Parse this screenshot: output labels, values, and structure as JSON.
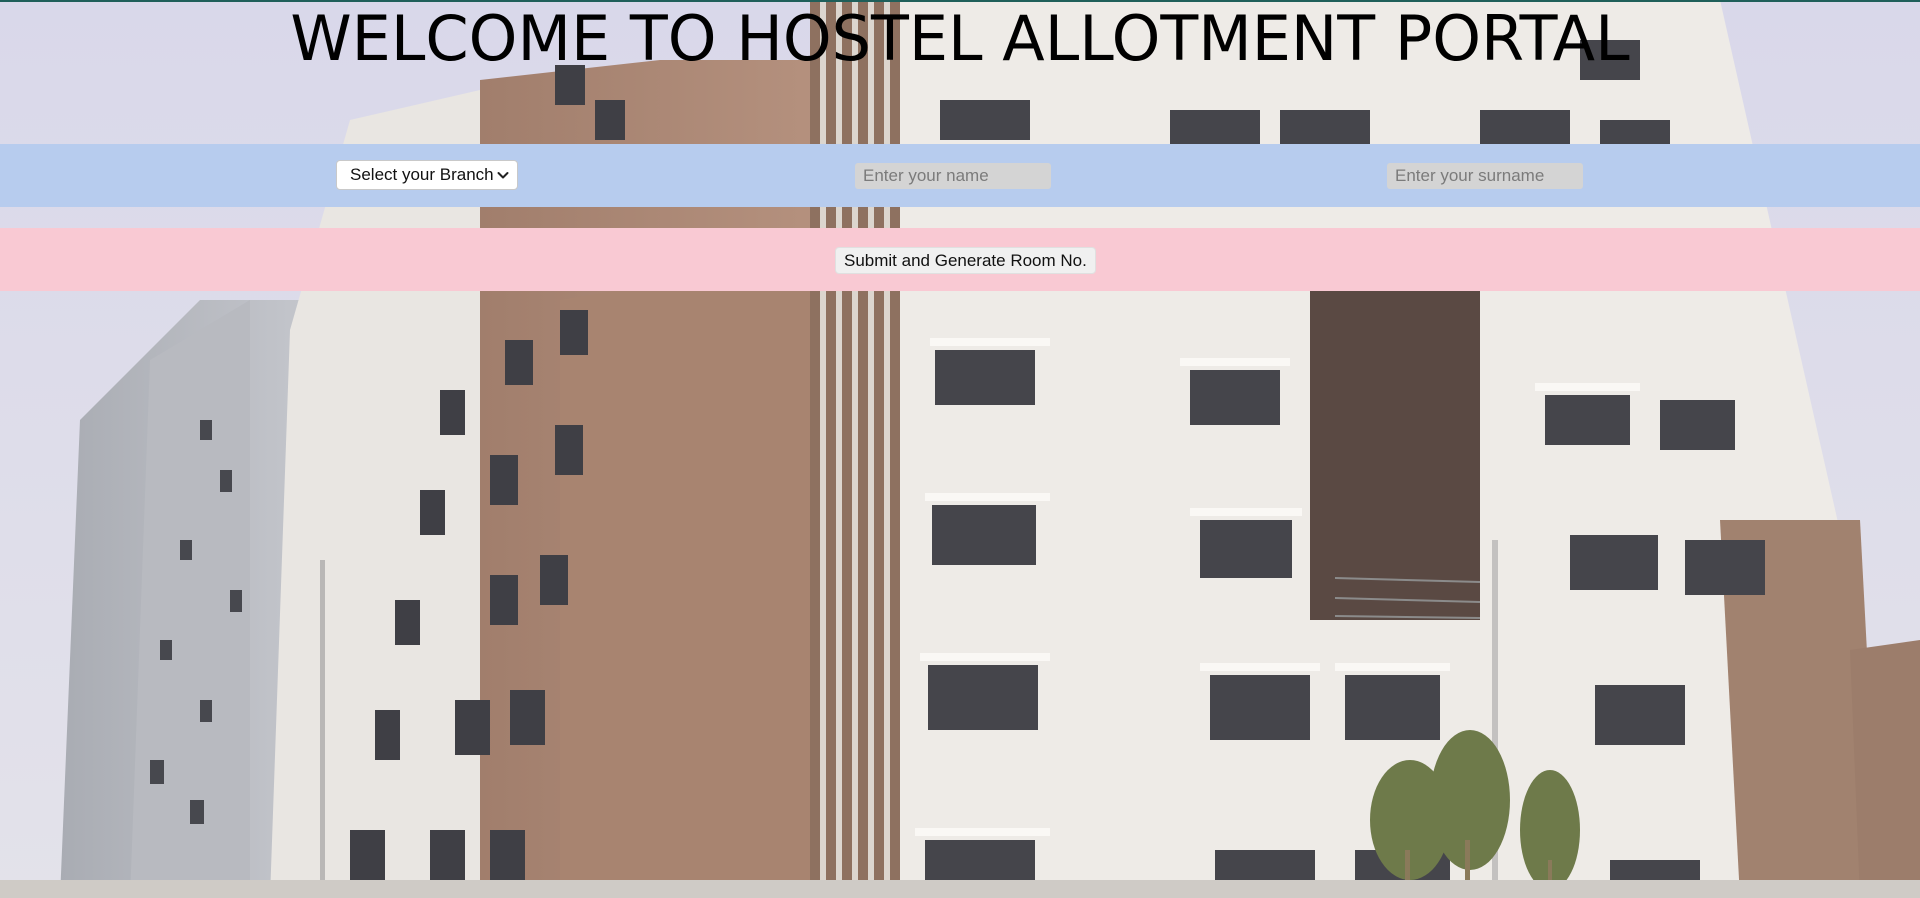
{
  "page": {
    "title": "WELCOME TO HOSTEL ALLOTMENT PORTAL"
  },
  "form": {
    "branch_select": {
      "selected": "Select your Branch"
    },
    "name_input": {
      "placeholder": "Enter your name",
      "value": ""
    },
    "surname_input": {
      "placeholder": "Enter your surname",
      "value": ""
    },
    "submit_label": "Submit and Generate Room No."
  },
  "colors": {
    "form_band": "#b7ccee",
    "submit_band": "#f9c9d3",
    "top_line": "#1f5f5a"
  },
  "icons": {
    "select_chevron": "chevron-down-icon"
  }
}
